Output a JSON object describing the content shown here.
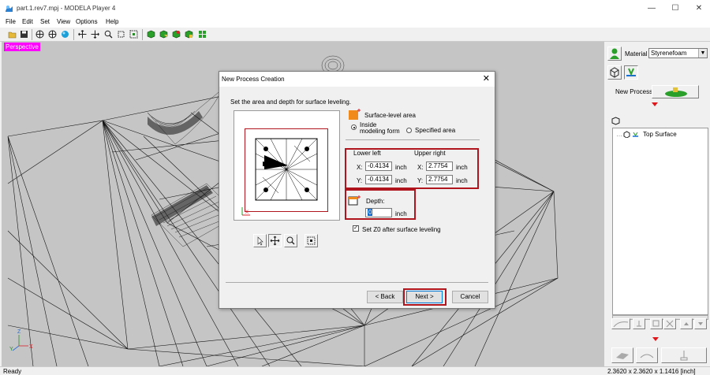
{
  "window": {
    "title": "part.1.rev7.mpj - MODELA Player 4"
  },
  "menu": [
    "File",
    "Edit",
    "Set",
    "View",
    "Options",
    "Help"
  ],
  "viewport": {
    "label": "Perspective"
  },
  "right_panel": {
    "material_label": "Material",
    "material_value": "Styrenefoam",
    "new_process_label": "New Process",
    "tree_item": "Top Surface"
  },
  "dialog": {
    "title": "New Process Creation",
    "instruction": "Set the area and depth for surface leveling.",
    "surface_level_area_label": "Surface-level area",
    "radio_inside": "Inside modeling form",
    "radio_inside_line1": "Inside",
    "radio_inside_line2": "modeling form",
    "radio_specified": "Specified area",
    "radio_selected": "Inside modeling form",
    "lower_left_label": "Lower left",
    "upper_right_label": "Upper right",
    "x_label": "X:",
    "y_label": "Y:",
    "lower_left_x": "-0.4134",
    "lower_left_y": "-0.4134",
    "upper_right_x": "2.7754",
    "upper_right_y": "2.7754",
    "unit": "inch",
    "depth_label": "Depth:",
    "depth_value": "0",
    "set_z0_label": "Set Z0 after surface leveling",
    "set_z0_checked": true,
    "back_button": "< Back",
    "next_button": "Next >",
    "cancel_button": "Cancel"
  },
  "status": {
    "text": "Ready",
    "dimensions": "2.3620 x 2.3620 x 1.1416 [inch]"
  },
  "colors": {
    "highlight_red": "#b0141c",
    "perspective_badge": "#ff00ff",
    "arrow_red": "#e0161b"
  }
}
